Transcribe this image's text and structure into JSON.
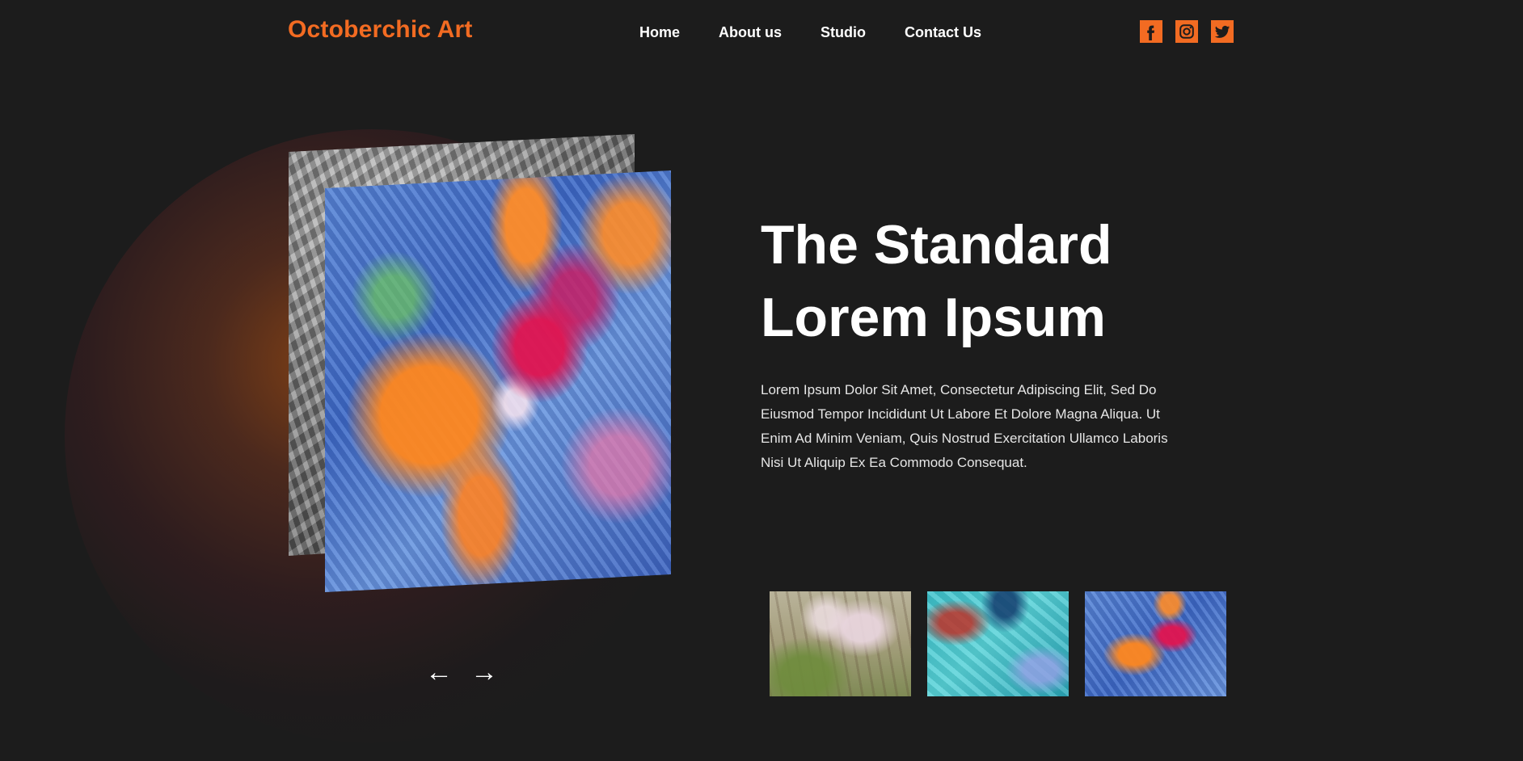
{
  "header": {
    "brand": "Octoberchic Art",
    "nav": [
      {
        "label": "Home"
      },
      {
        "label": "About us"
      },
      {
        "label": "Studio"
      },
      {
        "label": "Contact Us"
      }
    ],
    "social": [
      {
        "icon": "facebook-icon"
      },
      {
        "icon": "instagram-icon"
      },
      {
        "icon": "twitter-icon"
      }
    ]
  },
  "hero": {
    "title_line1": "The Standard",
    "title_line2": "Lorem Ipsum",
    "body": "Lorem Ipsum Dolor Sit Amet, Consectetur Adipiscing Elit, Sed Do Eiusmod Tempor Incididunt Ut Labore Et Dolore Magna Aliqua. Ut Enim Ad Minim Veniam, Quis Nostrud Exercitation Ullamco Laboris Nisi Ut Aliquip Ex Ea Commodo Consequat."
  },
  "slider": {
    "prev": "←",
    "next": "→"
  },
  "colors": {
    "accent": "#f26b22",
    "background": "#1c1c1c",
    "text": "#ffffff"
  }
}
